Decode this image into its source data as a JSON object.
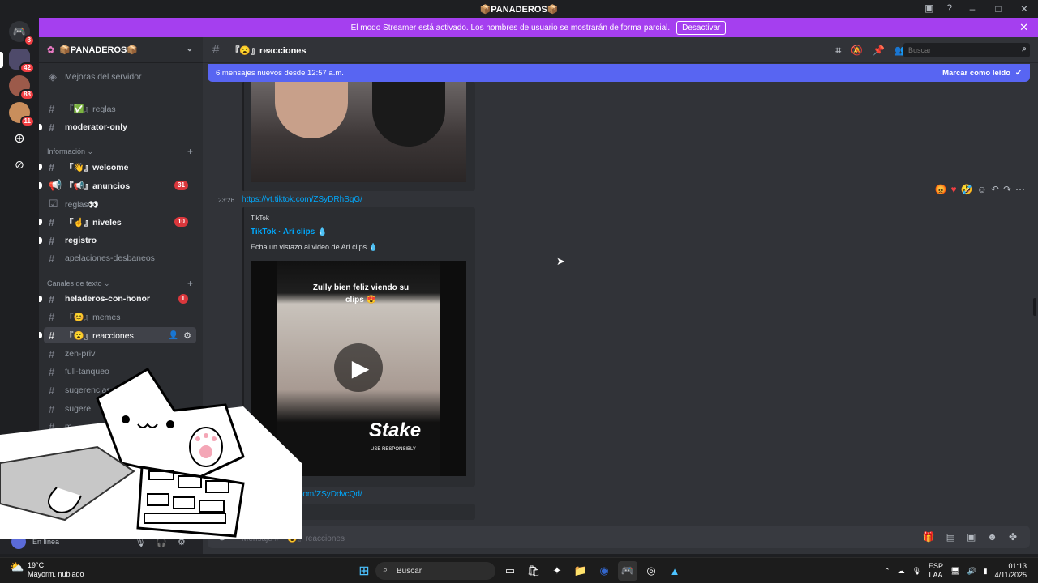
{
  "window": {
    "title": "📦PANADEROS📦"
  },
  "streamer": {
    "text": "El modo Streamer está activado. Los nombres de usuario se mostrarán de forma parcial.",
    "button": "Desactivar"
  },
  "servers": [
    {
      "badge": "8"
    },
    {
      "badge": "42"
    },
    {
      "badge": "88"
    },
    {
      "badge": "11"
    }
  ],
  "guild": {
    "name": "📦PANADEROS📦"
  },
  "channels": {
    "boosts": "Mejoras del servidor",
    "reglas": "『✅』reglas",
    "moderator": "moderator-only",
    "cat_info": "Información ⌄",
    "welcome": "『👋』welcome",
    "anuncios": "『📢』anuncios",
    "anuncios_count": "31",
    "reglas2": "reglas👀",
    "niveles": "『☝』niveles",
    "niveles_count": "10",
    "registro": "registro",
    "apelaciones": "apelaciones-desbaneos",
    "cat_text": "Canales de texto ⌄",
    "heladeros": "heladeros-con-honor",
    "heladeros_count": "1",
    "memes": "『😊』memes",
    "reacciones": "『😮』reacciones",
    "zen": "zen-priv",
    "full": "full-tanqueo",
    "sugerencias": "sugerencias",
    "sugerencias2": "sugere",
    "m": "m"
  },
  "user": {
    "status": "En línea"
  },
  "header": {
    "channel": "『😮』reacciones",
    "search_placeholder": "Buscar"
  },
  "newbar": {
    "text": "6 mensajes nuevos desde 12:57 a.m.",
    "mark": "Marcar como leído"
  },
  "messages": {
    "time": "23:26",
    "link1": "https://vt.tiktok.com/ZSyDRhSqG/",
    "provider": "TikTok",
    "embed_title": "TikTok · Ari clips 💧",
    "embed_desc": "Echa un vistazo al video de Ari clips 💧.",
    "video_caption": "Zully bien feliz viendo su clips 😍",
    "stake_text": "Stake",
    "stake_sub": "USE RESPONSIBLY",
    "link2": "...com/ZSyDdvcQd/"
  },
  "composer": {
    "placeholder": "Mensaje #『😮』reacciones"
  },
  "taskbar": {
    "weather_temp": "19°C",
    "weather_desc": "Mayorm. nublado",
    "search": "Buscar",
    "lang1": "ESP",
    "lang2": "LAA",
    "time": "01:13",
    "date": "4/11/2025"
  },
  "colors": {
    "accent": "#5865f2",
    "streamer": "#a53fef",
    "badge": "#da373c"
  }
}
